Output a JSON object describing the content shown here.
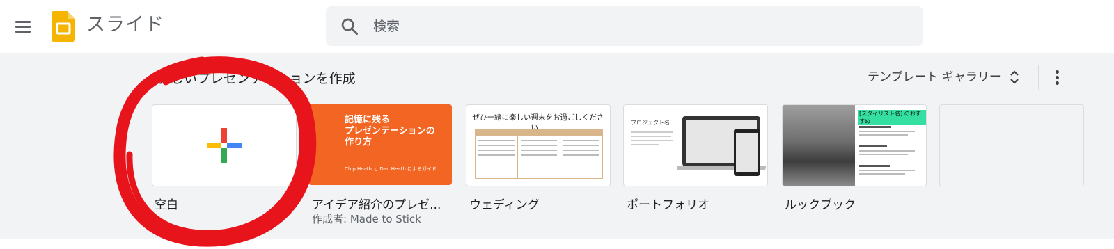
{
  "header": {
    "app_title": "スライド",
    "search": {
      "placeholder": "検索"
    },
    "icons": [
      "menu-icon",
      "slides-logo-icon",
      "search-icon"
    ]
  },
  "templates": {
    "section_title": "新しいプレゼンテーションを作成",
    "gallery_label": "テンプレート ギャラリー",
    "items": [
      {
        "label": "空白"
      },
      {
        "label": "アイデア紹介のプレゼ...",
        "sub": "作成者: Made to Stick",
        "thumb": {
          "title": "記憶に残る\nプレゼンテーションの\n作り方",
          "author": "Chip Heath と Dan Heath によるガイド"
        }
      },
      {
        "label": "ウェディング",
        "thumb": {
          "title": "ぜひー緒に楽しい週末をお過ごしください。"
        }
      },
      {
        "label": "ポートフォリオ",
        "thumb": {
          "title": "プロジェクト名"
        }
      },
      {
        "label": "ルックブック",
        "thumb": {
          "tag": "[スタイリスト名] のおすすめ"
        }
      }
    ]
  },
  "colors": {
    "slides_yellow": "#f4b400",
    "orange_template": "#f26522",
    "annotation_red": "#e8141b",
    "plus_red": "#ea4335",
    "plus_blue": "#4285f4",
    "plus_green": "#34a853",
    "plus_yellow": "#fbbc04"
  }
}
